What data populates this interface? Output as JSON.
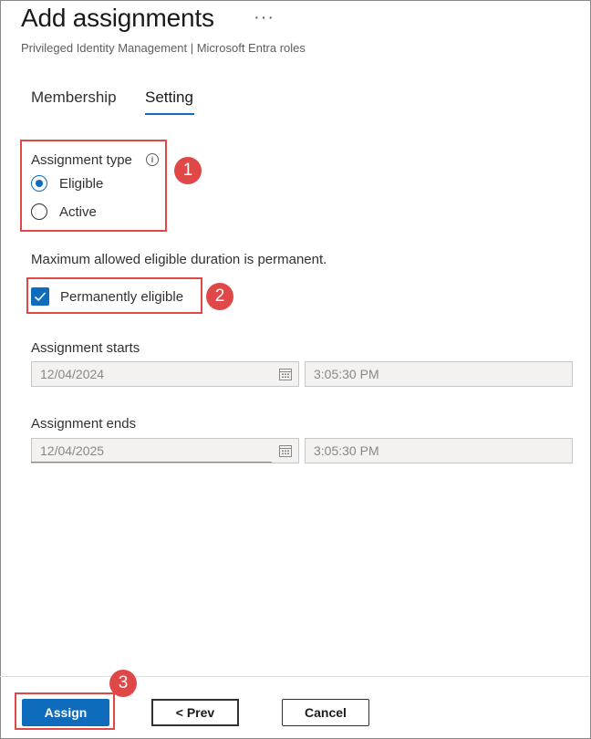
{
  "header": {
    "title": "Add assignments",
    "more_label": "···",
    "subtitle": "Privileged Identity Management | Microsoft Entra roles"
  },
  "tabs": [
    {
      "label": "Membership",
      "active": false
    },
    {
      "label": "Setting",
      "active": true
    }
  ],
  "assignment_type": {
    "label": "Assignment type",
    "info_icon": "i",
    "options": [
      {
        "label": "Eligible",
        "selected": true
      },
      {
        "label": "Active",
        "selected": false
      }
    ]
  },
  "duration_note": "Maximum allowed eligible duration is permanent.",
  "permanently_eligible": {
    "label": "Permanently eligible",
    "checked": true
  },
  "assignment_starts": {
    "label": "Assignment starts",
    "date": "12/04/2024",
    "time": "3:05:30 PM"
  },
  "assignment_ends": {
    "label": "Assignment ends",
    "date": "12/04/2025",
    "time": "3:05:30 PM"
  },
  "footer": {
    "assign_label": "Assign",
    "prev_label": "< Prev",
    "cancel_label": "Cancel"
  },
  "annotations": [
    "1",
    "2",
    "3"
  ],
  "colors": {
    "accent": "#0f6cbd",
    "highlight": "#e04848",
    "disabled_field": "#f3f2f1"
  }
}
